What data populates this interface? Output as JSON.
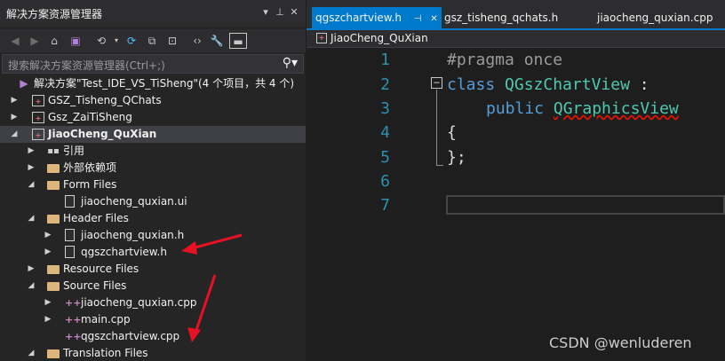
{
  "solution_explorer": {
    "title": "解决方案资源管理器",
    "title_buttons": [
      "▾",
      "⊥",
      "✕"
    ],
    "search_placeholder": "搜索解决方案资源管理器(Ctrl+;)",
    "tree": [
      {
        "label": "解决方案\"Test_IDE_VS_TiSheng\"(4 个项目，共 4 个)",
        "icon": "solution-icon",
        "level": 0,
        "expander": ""
      },
      {
        "label": "GSZ_Tisheng_QChats",
        "icon": "project-icon",
        "level": 0,
        "expander": "▶"
      },
      {
        "label": "Gsz_ZaiTiSheng",
        "icon": "project-icon",
        "level": 0,
        "expander": "▶"
      },
      {
        "label": "JiaoCheng_QuXian",
        "icon": "project-icon",
        "level": 0,
        "expander": "◢",
        "bold": true,
        "selected": true
      },
      {
        "label": "引用",
        "icon": "references-icon",
        "level": 1,
        "expander": "▶"
      },
      {
        "label": "外部依赖项",
        "icon": "folder-icon",
        "level": 1,
        "expander": "▶"
      },
      {
        "label": "Form Files",
        "icon": "folder-icon",
        "level": 1,
        "expander": "◢"
      },
      {
        "label": "jiaocheng_quxian.ui",
        "icon": "file-icon",
        "level": 2,
        "expander": ""
      },
      {
        "label": "Header Files",
        "icon": "folder-icon",
        "level": 1,
        "expander": "◢"
      },
      {
        "label": "jiaocheng_quxian.h",
        "icon": "header-file-icon",
        "level": 2,
        "expander": "▶"
      },
      {
        "label": "qgszchartview.h",
        "icon": "header-file-icon",
        "level": 2,
        "expander": "▶"
      },
      {
        "label": "Resource Files",
        "icon": "folder-icon",
        "level": 1,
        "expander": "▶"
      },
      {
        "label": "Source Files",
        "icon": "folder-icon",
        "level": 1,
        "expander": "◢"
      },
      {
        "label": "jiaocheng_quxian.cpp",
        "icon": "cpp-file-icon",
        "level": 2,
        "expander": "▶"
      },
      {
        "label": "main.cpp",
        "icon": "cpp-file-icon",
        "level": 2,
        "expander": "▶"
      },
      {
        "label": "qgszchartview.cpp",
        "icon": "cpp-file-icon",
        "level": 2,
        "expander": ""
      },
      {
        "label": "Translation Files",
        "icon": "folder-icon",
        "level": 1,
        "expander": "◢"
      }
    ]
  },
  "editor": {
    "tabs": [
      {
        "label": "qgszchartview.h",
        "pin": "⊣",
        "close": "✕",
        "active": true
      },
      {
        "label": "gsz_tisheng_qchats.h",
        "active": false
      },
      {
        "label": "jiaocheng_quxian.cpp",
        "active": false
      }
    ],
    "nav_project": "JiaoCheng_QuXian",
    "line_numbers": [
      "1",
      "2",
      "3",
      "4",
      "5",
      "6",
      "7"
    ],
    "code": {
      "l1": "#pragma once",
      "l2_kw": "class",
      "l2_name": "QGszChartView",
      "l2_colon": " :",
      "l3_kw": "public",
      "l3_base": "QGraphicsView",
      "l4": "{",
      "l5": "};"
    }
  },
  "watermark": "CSDN @wenluderen",
  "colors": {
    "accent": "#007acc",
    "arrow": "#e81123"
  }
}
